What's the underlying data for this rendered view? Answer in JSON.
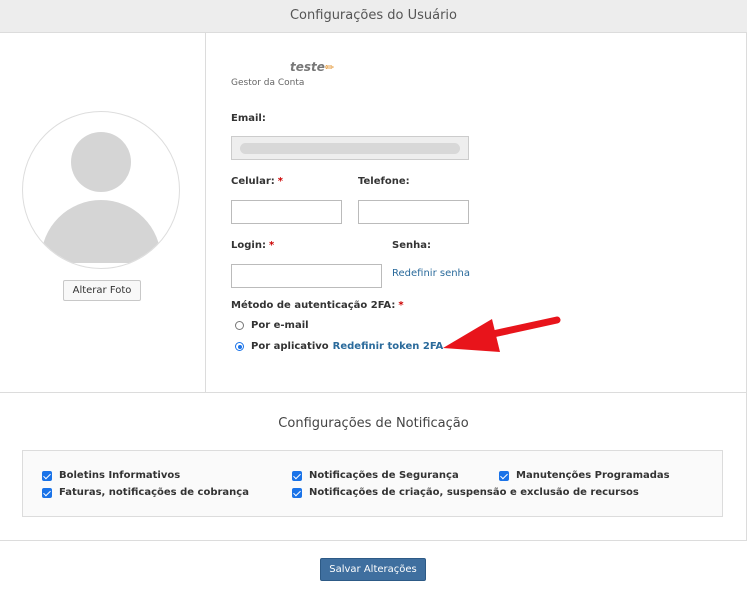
{
  "header": {
    "title": "Configurações do Usuário"
  },
  "profile": {
    "name": "teste",
    "role": "Gestor da Conta",
    "change_photo_label": "Alterar Foto"
  },
  "form": {
    "email_label": "Email:",
    "email_value": "",
    "mobile_label": "Celular:",
    "mobile_value": "",
    "phone_label": "Telefone:",
    "phone_value": "",
    "login_label": "Login:",
    "login_value": "",
    "password_label": "Senha:",
    "reset_password_link": "Redefinir senha",
    "required_mark": "*",
    "twofa_label": "Método de autenticação 2FA:",
    "twofa_options": [
      {
        "label": "Por e-mail",
        "selected": false
      },
      {
        "label": "Por aplicativo",
        "selected": true
      }
    ],
    "reset_token_link": "Redefinir token 2FA"
  },
  "notifications": {
    "title": "Configurações de Notificação",
    "items": [
      {
        "label": "Boletins Informativos",
        "checked": true
      },
      {
        "label": "Notificações de Segurança",
        "checked": true
      },
      {
        "label": "Manutenções Programadas",
        "checked": true
      },
      {
        "label": "Faturas, notificações de cobrança",
        "checked": true
      },
      {
        "label": "Notificações de criação, suspensão e exclusão de recursos",
        "checked": true
      }
    ]
  },
  "actions": {
    "save_label": "Salvar Alterações"
  },
  "colors": {
    "accent": "#1a73e8",
    "link": "#2a6a9b",
    "button": "#3f6f9f",
    "required": "#cc0000",
    "annotation_arrow": "#e8141b"
  },
  "icons": {
    "edit": "pencil-icon",
    "avatar": "avatar-placeholder-icon",
    "annotation": "red-arrow-icon"
  }
}
